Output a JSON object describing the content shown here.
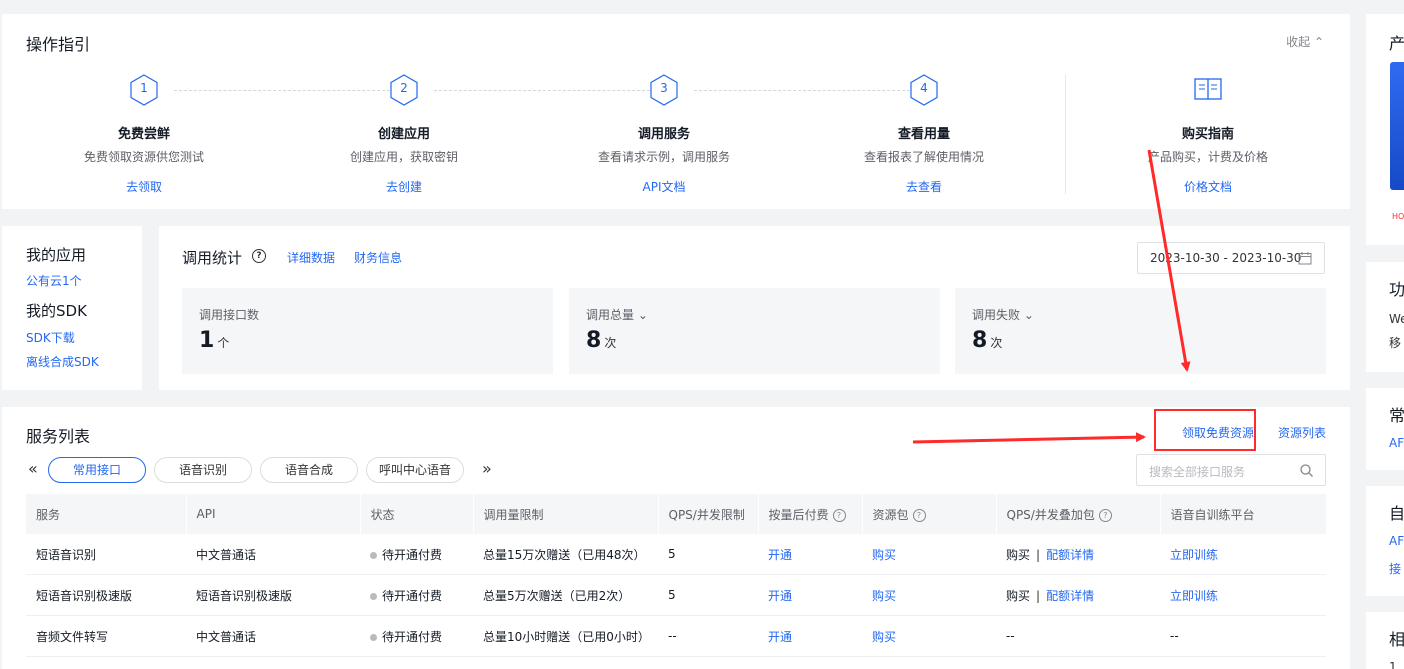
{
  "guide": {
    "title": "操作指引",
    "collapse": "收起",
    "steps": [
      {
        "num": "1",
        "title": "免费尝鲜",
        "desc": "免费领取资源供您测试",
        "link": "去领取"
      },
      {
        "num": "2",
        "title": "创建应用",
        "desc": "创建应用，获取密钥",
        "link": "去创建"
      },
      {
        "num": "3",
        "title": "调用服务",
        "desc": "查看请求示例，调用服务",
        "link": "API文档"
      },
      {
        "num": "4",
        "title": "查看用量",
        "desc": "查看报表了解使用情况",
        "link": "去查看"
      }
    ],
    "buy": {
      "title": "购买指南",
      "desc": "产品购买，计费及价格",
      "link": "价格文档"
    }
  },
  "apps": {
    "my_app": "我的应用",
    "public_cloud": "公有云1个",
    "my_sdk": "我的SDK",
    "sdk_download": "SDK下载",
    "offline_sdk": "离线合成SDK"
  },
  "stats": {
    "title": "调用统计",
    "help": "?",
    "detail": "详细数据",
    "finance": "财务信息",
    "date_range": "2023-10-30 - 2023-10-30",
    "cards": [
      {
        "label": "调用接口数",
        "value": "1",
        "unit": "个"
      },
      {
        "label": "调用总量",
        "value": "8",
        "unit": "次"
      },
      {
        "label": "调用失败",
        "value": "8",
        "unit": "次"
      }
    ]
  },
  "services": {
    "title": "服务列表",
    "free_resources": "领取免费资源",
    "resource_list": "资源列表",
    "tabs": [
      "常用接口",
      "语音识别",
      "语音合成",
      "呼叫中心语音"
    ],
    "search_placeholder": "搜索全部接口服务",
    "columns": [
      "服务",
      "API",
      "状态",
      "调用量限制",
      "QPS/并发限制",
      "按量后付费",
      "资源包",
      "QPS/并发叠加包",
      "语音自训练平台"
    ],
    "rows": [
      {
        "service": "短语音识别",
        "api": "中文普通话",
        "status": "待开通付费",
        "limit": "总量15万次赠送（已用48次）",
        "qps": "5",
        "postpaid": "开通",
        "package": "购买",
        "qps_buy": "购买",
        "qps_detail": "配额详情",
        "train": "立即训练"
      },
      {
        "service": "短语音识别极速版",
        "api": "短语音识别极速版",
        "status": "待开通付费",
        "limit": "总量5万次赠送（已用2次）",
        "qps": "5",
        "postpaid": "开通",
        "package": "购买",
        "qps_buy": "购买",
        "qps_detail": "配额详情",
        "train": "立即训练"
      },
      {
        "service": "音频文件转写",
        "api": "中文普通话",
        "status": "待开通付费",
        "limit": "总量10小时赠送（已用0小时）",
        "qps": "--",
        "postpaid": "开通",
        "package": "购买",
        "qps_buy": "--",
        "qps_detail": "",
        "train": "--"
      }
    ]
  },
  "right": {
    "c1": "产",
    "c1_small": "HO",
    "c2": "功",
    "c2_a": "We",
    "c2_b": "移",
    "c3": "常",
    "c3_a": "AF",
    "c4": "自",
    "c4_a": "AF",
    "c4_b": "接",
    "c5": "相",
    "c5_a": "1"
  },
  "colors": {
    "accent": "#2468f2",
    "annotation_red": "#ff2a2a"
  }
}
